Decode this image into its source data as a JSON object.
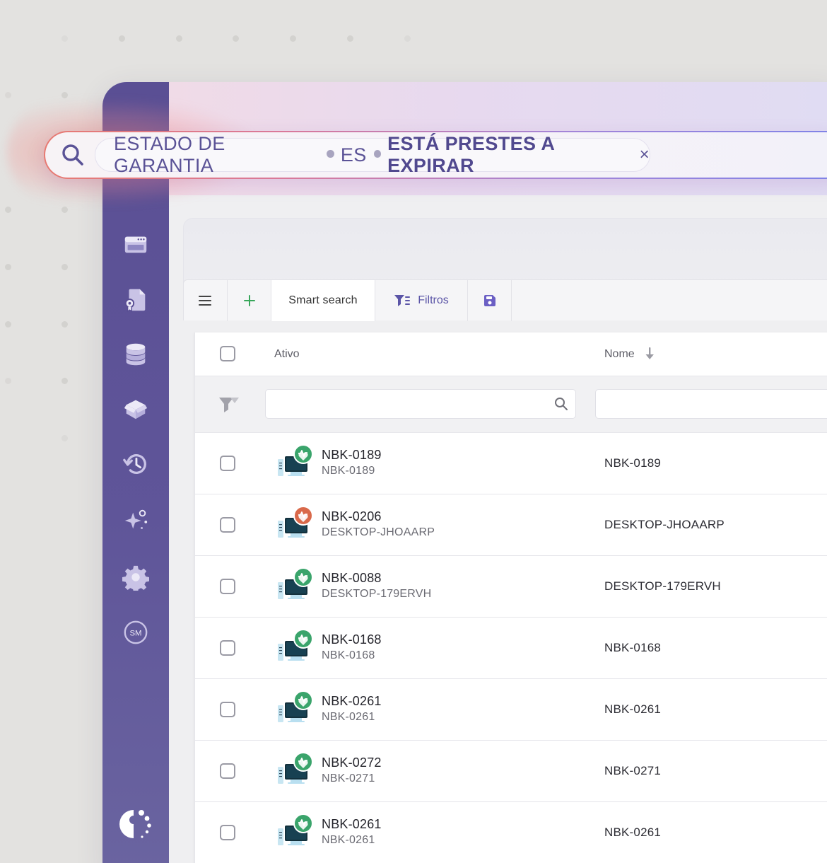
{
  "search": {
    "field": "ESTADO DE GARANTIA",
    "operator": "ES",
    "value": "ESTÁ PRESTES A EXPIRAR",
    "remove_symbol": "×"
  },
  "toolbar": {
    "smart_search_label": "Smart search",
    "filters_label": "Filtros"
  },
  "table": {
    "columns": {
      "asset": "Ativo",
      "name": "Nome"
    },
    "rows": [
      {
        "title": "NBK-0189",
        "subtitle": "NBK-0189",
        "name": "NBK-0189",
        "status": "ok"
      },
      {
        "title": "NBK-0206",
        "subtitle": "DESKTOP-JHOAARP",
        "name": "DESKTOP-JHOAARP",
        "status": "warning"
      },
      {
        "title": "NBK-0088",
        "subtitle": "DESKTOP-179ERVH",
        "name": "DESKTOP-179ERVH",
        "status": "ok"
      },
      {
        "title": "NBK-0168",
        "subtitle": "NBK-0168",
        "name": "NBK-0168",
        "status": "ok"
      },
      {
        "title": "NBK-0261",
        "subtitle": "NBK-0261",
        "name": "NBK-0261",
        "status": "ok"
      },
      {
        "title": "NBK-0272",
        "subtitle": "NBK-0271",
        "name": "NBK-0271",
        "status": "ok"
      },
      {
        "title": "NBK-0261",
        "subtitle": "NBK-0261",
        "name": "NBK-0261",
        "status": "ok"
      }
    ]
  },
  "sidebar": {
    "user_initials": "SM",
    "icons": [
      "dashboard-icon",
      "document-certificate-icon",
      "database-icon",
      "package-icon",
      "history-icon",
      "sparkle-icon",
      "gear-icon",
      "user-avatar-icon",
      "logo-icon"
    ]
  },
  "colors": {
    "sidebar": "#5a4f94",
    "accent": "#5b55a7",
    "status_ok": "#3aa46b",
    "status_warning": "#d9694a",
    "add": "#37a65a"
  }
}
